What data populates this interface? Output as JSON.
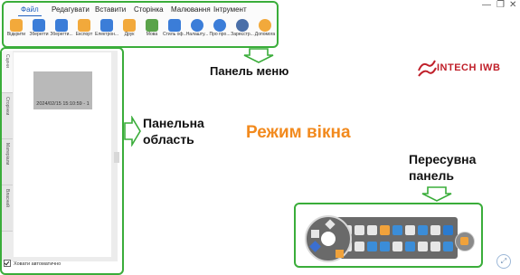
{
  "menu": {
    "tabs": [
      {
        "label": "Файл",
        "active": true
      },
      {
        "label": "Редагувати",
        "active": false
      },
      {
        "label": "Вставити",
        "active": false
      },
      {
        "label": "Сторінка",
        "active": false
      },
      {
        "label": "Малювання",
        "active": false
      },
      {
        "label": "Інтрумент",
        "active": false
      }
    ],
    "toolbar": [
      {
        "label": "Відкрити",
        "icon": "open-folder-icon",
        "color": "#f2a93b"
      },
      {
        "label": "Зберегти",
        "icon": "save-icon",
        "color": "#3b7dd8"
      },
      {
        "label": "Зберегти...",
        "icon": "save-as-icon",
        "color": "#3b7dd8"
      },
      {
        "label": "Експорт",
        "icon": "export-icon",
        "color": "#f2a93b"
      },
      {
        "label": "Електрон...",
        "icon": "email-icon",
        "color": "#3b7dd8"
      },
      {
        "label": "Друк",
        "icon": "print-icon",
        "color": "#f2a93b"
      },
      {
        "label": "Мова",
        "icon": "language-icon",
        "color": "#5aa34a"
      },
      {
        "label": "Стиль оф...",
        "icon": "style-icon",
        "color": "#3b7dd8"
      },
      {
        "label": "Налашту...",
        "icon": "settings-icon",
        "color": "#3b7dd8"
      },
      {
        "label": "Про про...",
        "icon": "about-icon",
        "color": "#3b7dd8"
      },
      {
        "label": "Зареєстр...",
        "icon": "register-icon",
        "color": "#4a6fa8"
      },
      {
        "label": "Допомога",
        "icon": "help-icon",
        "color": "#f2a93b"
      }
    ]
  },
  "window_controls": {
    "minimize": "—",
    "restore": "❐",
    "close": "✕"
  },
  "labels": {
    "menu_panel": "Панель меню",
    "side_panel_line1": "Панельна",
    "side_panel_line2": "область",
    "mode_title": "Режим вікна",
    "floating_line1": "Пересувна",
    "floating_line2": "панель"
  },
  "logo": {
    "text": "INTECH IWB",
    "color": "#c0202a"
  },
  "side_panel": {
    "tabs": [
      "Сцени",
      "Сторінки",
      "Матеріали",
      "Власний"
    ],
    "thumbnail_caption": "2024/02/15 15:10:59 - 1",
    "footer_checkbox_label": "Ховати автоматично"
  },
  "colors": {
    "frame_green": "#3aad3a",
    "accent_orange": "#f28a1e"
  }
}
